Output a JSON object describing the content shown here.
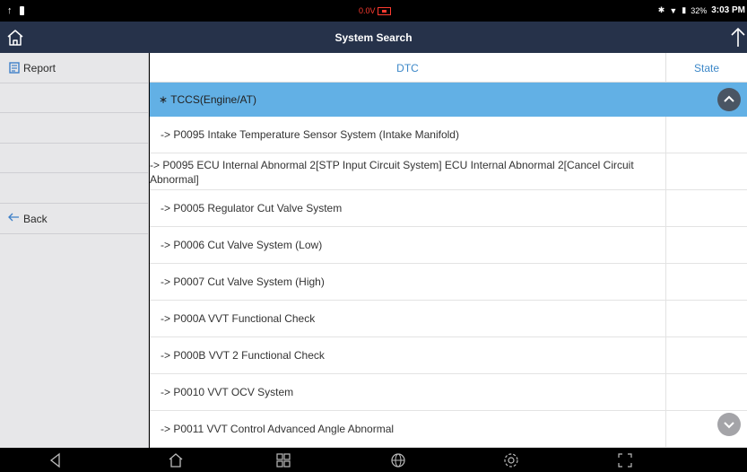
{
  "status_bar": {
    "voltage": "0.0V",
    "battery_percent": "32%",
    "time": "3:03 PM",
    "voltage_color": "#ff3b30"
  },
  "title_bar": {
    "title": "System Search",
    "home_icon": "home-icon",
    "export_icon": "upload-arrow-icon"
  },
  "sidebar": {
    "report_label": "Report",
    "back_label": "Back",
    "report_icon": "report-icon",
    "back_icon": "back-arrow-icon"
  },
  "table": {
    "headers": {
      "dtc": "DTC",
      "state": "State"
    },
    "header_color": "#3d88c8",
    "group": {
      "label": "TCCS(Engine/AT)",
      "highlight_color": "#62b0e5",
      "symbol": "∗"
    },
    "rows": [
      {
        "text": "-> P0095 Intake Temperature Sensor System (Intake Manifold)",
        "state": ""
      },
      {
        "text": "-> P0095 ECU Internal Abnormal 2[STP Input Circuit System] ECU Internal Abnormal 2[Cancel Circuit Abnormal]",
        "state": ""
      },
      {
        "text": "-> P0005 Regulator Cut Valve System",
        "state": ""
      },
      {
        "text": "-> P0006 Cut Valve System (Low)",
        "state": ""
      },
      {
        "text": "-> P0007 Cut Valve System (High)",
        "state": ""
      },
      {
        "text": "-> P000A VVT Functional Check",
        "state": ""
      },
      {
        "text": "-> P000B VVT 2 Functional Check",
        "state": ""
      },
      {
        "text": "-> P0010 VVT OCV System",
        "state": ""
      },
      {
        "text": "-> P0011 VVT Control Advanced Angle Abnormal",
        "state": ""
      }
    ]
  },
  "nav_bar": {
    "icons": [
      "back-triangle-icon",
      "home-icon",
      "apps-grid-icon",
      "browser-globe-icon",
      "settings-gear-icon",
      "screenshot-icon"
    ]
  }
}
